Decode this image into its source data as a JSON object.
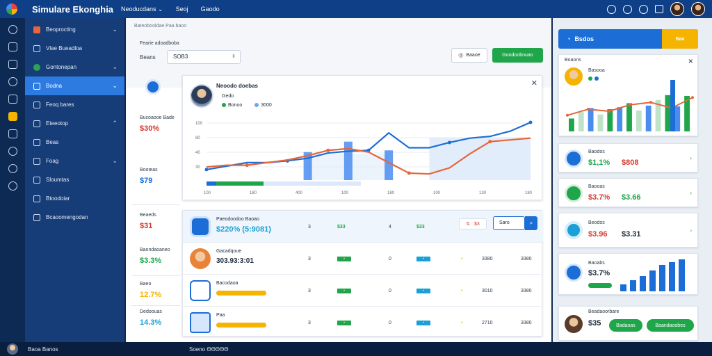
{
  "app": {
    "title": "Simulare Ekonghia",
    "nav": [
      "Neoducdans ⌄",
      "Seoj",
      "Gaodo"
    ]
  },
  "sidebar": {
    "items": [
      {
        "label": "Beoprocting",
        "chev": "⌄"
      },
      {
        "label": "Vlae Bueadloa",
        "chev": ""
      },
      {
        "label": "Gontonepan",
        "chev": "⌄"
      },
      {
        "label": "Bodna",
        "chev": "⌄"
      },
      {
        "label": "Feoq bares",
        "chev": ""
      },
      {
        "label": "Eteeotop",
        "chev": "⌃"
      },
      {
        "label": "Beas",
        "chev": ""
      },
      {
        "label": "Foag",
        "chev": "⌄"
      },
      {
        "label": "Sloumtas",
        "chev": ""
      },
      {
        "label": "Btoodoiar",
        "chev": ""
      },
      {
        "label": "Bcaoomengodan",
        "chev": ""
      }
    ]
  },
  "bottombar": {
    "left": "Baoa Banos",
    "center": "Soeno ΘΘΘΘΘ"
  },
  "main": {
    "crumb": "Bateobooldae Paa baoo",
    "form_label": "Fearie adoadboba",
    "field_label": "Beans",
    "field_value": "SOB3",
    "btn_outline": "Baaoe",
    "btn_green": "Goodoobnuao",
    "stats": [
      {
        "label": "Bucoaooe Bade",
        "value": "$30%",
        "color": "#d8392e"
      },
      {
        "label": "Booteas",
        "value": "$79",
        "color": "#1c6ed6"
      },
      {
        "label": "Beaeds",
        "value": "$31",
        "color": "#d8392e"
      },
      {
        "label": "Baondaoaneo",
        "value": "$3.3%",
        "color": "#1fa54a"
      },
      {
        "label": "Baeo",
        "value": "12.7%",
        "color": "#f4b400"
      },
      {
        "label": "Dedoouas",
        "value": "14.3%",
        "color": "#1a9fd6"
      }
    ],
    "chart_title": "Neoodo doebas",
    "chart_sub": "Gedo",
    "chart_legend": [
      "Bonoo",
      "3000"
    ]
  },
  "chart_data": {
    "type": "line",
    "x": [
      "1",
      "2",
      "3",
      "4",
      "5",
      "6",
      "7",
      "8",
      "9",
      "10",
      "11",
      "12",
      "13",
      "14",
      "15",
      "16",
      "17"
    ],
    "y_ticks": [
      "100",
      "80",
      "40",
      "30"
    ],
    "x_ticks": [
      "100",
      "180",
      "400",
      "100",
      "180",
      "100",
      "130",
      "180"
    ],
    "series": [
      {
        "name": "",
        "color": "#1c6ed6",
        "values": [
          42,
          46,
          50,
          50,
          52,
          55,
          61,
          63,
          64,
          84,
          67,
          67,
          73,
          78,
          80,
          86,
          96
        ]
      },
      {
        "name": "",
        "color": "#e8643a",
        "values": [
          45,
          47,
          47,
          50,
          53,
          58,
          64,
          66,
          62,
          50,
          38,
          37,
          44,
          60,
          74,
          76,
          78
        ]
      }
    ],
    "bars": [
      0,
      0,
      0,
      0,
      0,
      62,
      0,
      74,
      0,
      64,
      0,
      0,
      0,
      0,
      0,
      0,
      0
    ]
  },
  "table": {
    "head": {
      "name": "Paeodoodoo Baoao",
      "main": "$220% (5:9081)",
      "c1": "3",
      "c2": "$33",
      "c3": "4",
      "c4": "$33",
      "btn": "$3",
      "search": "Saro"
    },
    "rows": [
      {
        "name": "Gacadqoue",
        "main": "303.93:3:01",
        "c1": "3",
        "c4": "0",
        "c5": "3380",
        "c6": "3380",
        "color": "#e8843a"
      },
      {
        "name": "Bacodaoa",
        "main": "",
        "c1": "3",
        "c4": "0",
        "c5": "3010",
        "c6": "3380",
        "color": "#f4b400"
      },
      {
        "name": "Paa",
        "main": "",
        "c1": "3",
        "c4": "0",
        "c5": "2710",
        "c6": "3380",
        "color": "#1c6ed6"
      }
    ]
  },
  "right": {
    "header": "Bsdos",
    "header_btn": "Baa",
    "card1": {
      "name": "Boaons",
      "sub": "Basooa",
      "series": [
        32,
        48,
        58,
        42,
        55,
        60,
        70,
        52,
        64,
        78,
        90,
        62,
        88
      ],
      "accent": [
        40,
        55,
        50,
        66,
        72,
        58,
        84
      ]
    },
    "cards": [
      {
        "label": "Baodos",
        "value": "$1,1%",
        "value2": "$808",
        "color": "#1fa54a",
        "color2": "#d8392e",
        "icon": "#1c6ed6"
      },
      {
        "label": "Baooas",
        "value": "$3.7%",
        "value2": "$3.66",
        "color": "#d8392e",
        "color2": "#1fa54a",
        "icon": "#1fa54a"
      },
      {
        "label": "Beodos",
        "value": "$3.96",
        "value2": "$3.31",
        "color": "#d8392e",
        "color2": "#1d2b3a",
        "icon": "#1a9fd6"
      },
      {
        "label": "Baoabs",
        "value": "$3.7%",
        "value2": "",
        "color": "#1d2b3a",
        "color2": "#1d2b3a",
        "icon": "#1c6ed6"
      }
    ],
    "mini_bars": [
      10,
      16,
      22,
      30,
      38,
      42,
      46
    ],
    "footer": {
      "label": "Beadaoorbare",
      "value": "$35",
      "btn1": "Badaoas",
      "btn2": "Baandaoobes"
    }
  }
}
